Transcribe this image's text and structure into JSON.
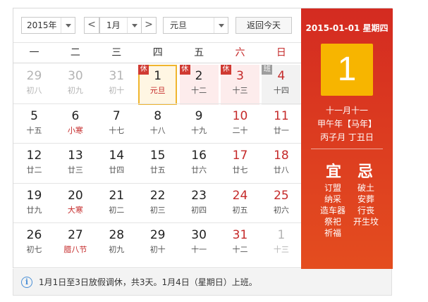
{
  "toolbar": {
    "year": "2015年",
    "month": "1月",
    "holiday": "元旦",
    "prev": "<",
    "next": ">",
    "today_button": "返回今天"
  },
  "weekdays": [
    "一",
    "二",
    "三",
    "四",
    "五",
    "六",
    "日"
  ],
  "weeks": [
    [
      {
        "day": "29",
        "lunar": "初八",
        "dim": true
      },
      {
        "day": "30",
        "lunar": "初九",
        "dim": true
      },
      {
        "day": "31",
        "lunar": "初十",
        "dim": true
      },
      {
        "day": "1",
        "lunar": "元旦",
        "badge": "休",
        "selected": true
      },
      {
        "day": "2",
        "lunar": "十二",
        "badge": "休",
        "holiday": true
      },
      {
        "day": "3",
        "lunar": "十三",
        "badge": "休",
        "holiday": true,
        "red": true
      },
      {
        "day": "4",
        "lunar": "十四",
        "badge": "班",
        "workday": true,
        "red": true
      }
    ],
    [
      {
        "day": "5",
        "lunar": "十五"
      },
      {
        "day": "6",
        "lunar": "小寒",
        "term": true
      },
      {
        "day": "7",
        "lunar": "十七"
      },
      {
        "day": "8",
        "lunar": "十八"
      },
      {
        "day": "9",
        "lunar": "十九"
      },
      {
        "day": "10",
        "lunar": "二十",
        "red": true
      },
      {
        "day": "11",
        "lunar": "廿一",
        "red": true
      }
    ],
    [
      {
        "day": "12",
        "lunar": "廿二"
      },
      {
        "day": "13",
        "lunar": "廿三"
      },
      {
        "day": "14",
        "lunar": "廿四"
      },
      {
        "day": "15",
        "lunar": "廿五"
      },
      {
        "day": "16",
        "lunar": "廿六"
      },
      {
        "day": "17",
        "lunar": "廿七",
        "red": true
      },
      {
        "day": "18",
        "lunar": "廿八",
        "red": true
      }
    ],
    [
      {
        "day": "19",
        "lunar": "廿九"
      },
      {
        "day": "20",
        "lunar": "大寒",
        "term": true
      },
      {
        "day": "21",
        "lunar": "初二"
      },
      {
        "day": "22",
        "lunar": "初三"
      },
      {
        "day": "23",
        "lunar": "初四"
      },
      {
        "day": "24",
        "lunar": "初五",
        "red": true
      },
      {
        "day": "25",
        "lunar": "初六",
        "red": true
      }
    ],
    [
      {
        "day": "26",
        "lunar": "初七"
      },
      {
        "day": "27",
        "lunar": "腊八节",
        "term": true
      },
      {
        "day": "28",
        "lunar": "初九"
      },
      {
        "day": "29",
        "lunar": "初十"
      },
      {
        "day": "30",
        "lunar": "十一"
      },
      {
        "day": "31",
        "lunar": "十二",
        "red": true
      },
      {
        "day": "1",
        "lunar": "十三",
        "dim": true
      }
    ]
  ],
  "side": {
    "date": "2015-01-01  星期四",
    "big_day": "1",
    "lunar_date": "十一月十一",
    "ganzhi_year": "甲午年【马年】",
    "ganzhi_month_day": "丙子月 丁丑日",
    "yi_title": "宜",
    "ji_title": "忌",
    "yi": [
      "订盟",
      "纳采",
      "造车器",
      "祭祀",
      "祈福"
    ],
    "ji": [
      "破土",
      "安葬",
      "行丧",
      "开生坟"
    ]
  },
  "notice": "1月1日至3日放假调休，共3天。1月4日（星期日）上班。",
  "colors": {
    "accent_red": "#d42b21",
    "selected_gold": "#f7b500",
    "holiday_bg": "#fdecec"
  }
}
